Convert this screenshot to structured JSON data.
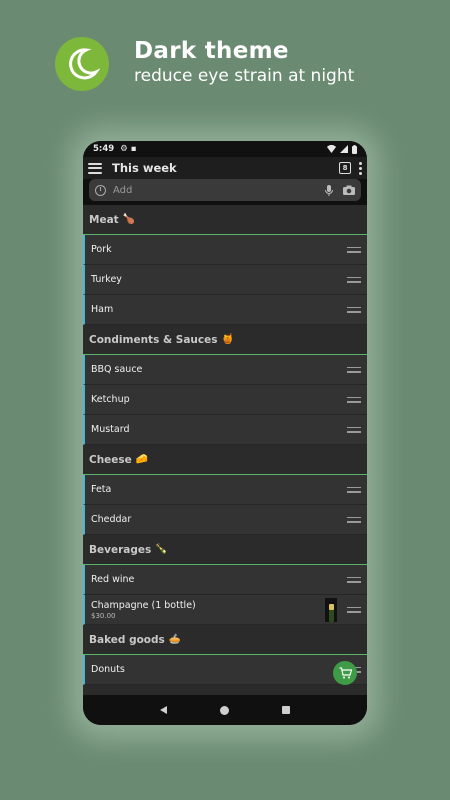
{
  "promo": {
    "title": "Dark theme",
    "subtitle": "reduce eye strain at night",
    "logo_icon": "moon-icon",
    "logo_color": "#7db83a"
  },
  "status_bar": {
    "time": "5:49",
    "icons": [
      "gear-icon",
      "sd-card-icon",
      "wifi-icon",
      "signal-icon",
      "battery-icon"
    ]
  },
  "toolbar": {
    "title": "This week",
    "calendar_badge": "8",
    "icons": [
      "hamburger-icon",
      "calendar-icon",
      "more-icon"
    ]
  },
  "add_bar": {
    "placeholder": "Add",
    "icons": [
      "clock-icon",
      "mic-icon",
      "camera-icon"
    ]
  },
  "sections": [
    {
      "title": "Meat",
      "emoji": "🍗",
      "items": [
        {
          "name": "Pork"
        },
        {
          "name": "Turkey"
        },
        {
          "name": "Ham"
        }
      ]
    },
    {
      "title": "Condiments & Sauces",
      "emoji": "🍯",
      "items": [
        {
          "name": "BBQ sauce"
        },
        {
          "name": "Ketchup"
        },
        {
          "name": "Mustard"
        }
      ]
    },
    {
      "title": "Cheese",
      "emoji": "🧀",
      "items": [
        {
          "name": "Feta"
        },
        {
          "name": "Cheddar"
        }
      ]
    },
    {
      "title": "Beverages",
      "emoji": "🍾",
      "items": [
        {
          "name": "Red wine"
        },
        {
          "name": "Champagne (1 bottle)",
          "price": "$30.00",
          "has_image": true
        }
      ]
    },
    {
      "title": "Baked goods",
      "emoji": "🥧",
      "items": [
        {
          "name": "Donuts"
        }
      ]
    }
  ],
  "colors": {
    "background": "#6a8a72",
    "accent_green": "#3e9b46",
    "item_border_blue": "#4fb3d9",
    "section_divider": "#59b36a"
  }
}
